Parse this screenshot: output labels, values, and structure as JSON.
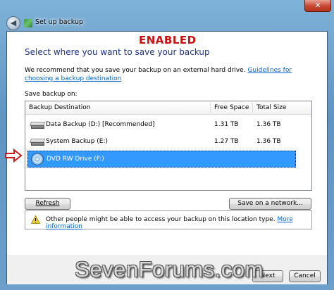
{
  "window": {
    "title": "Set up backup",
    "close_glyph": "✕",
    "back_glyph": "◀"
  },
  "annotation": {
    "text": "ENABLED",
    "color": "#cc1010"
  },
  "dialog": {
    "heading": "Select where you want to save your backup",
    "recommend_text": "We recommend that you save your backup on an external hard drive. ",
    "recommend_link": "Guidelines for choosing a backup destination",
    "save_on_label": "Save backup on:"
  },
  "table": {
    "columns": [
      "Backup Destination",
      "Free Space",
      "Total Size"
    ],
    "rows": [
      {
        "icon": "hard-drive-icon",
        "name": "Data Backup (D:) [Recommended]",
        "free": "1.31 TB",
        "total": "1.36 TB"
      },
      {
        "icon": "hard-drive-icon",
        "name": "System Backup (E:)",
        "free": "1.27 TB",
        "total": "1.36 TB"
      },
      {
        "icon": "dvd-drive-icon",
        "name": "DVD RW Drive (F:)",
        "free": "",
        "total": "",
        "selected": true
      }
    ]
  },
  "buttons": {
    "refresh": "Refresh",
    "save_network": "Save on a network...",
    "next": "Next",
    "cancel": "Cancel"
  },
  "info": {
    "text": "Other people might be able to access your backup on this location type. ",
    "link": "More information"
  },
  "watermark": "SevenForums.com",
  "colors": {
    "accent": "#1e3287",
    "link": "#0066cc",
    "selection": "#3399ff"
  }
}
